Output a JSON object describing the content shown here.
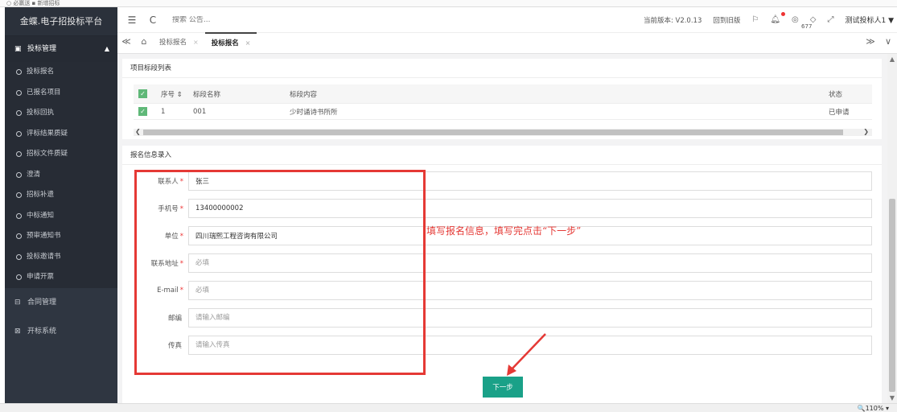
{
  "browser_strip": "○ 必赢送 ▪ 新增招标",
  "sidebar": {
    "brand": "金蝶.电子招投标平台",
    "group": {
      "icon": "▣",
      "label": "投标管理",
      "caret": "▲"
    },
    "items": [
      {
        "label": "投标报名"
      },
      {
        "label": "已报名项目"
      },
      {
        "label": "投标回执"
      },
      {
        "label": "评标结果质疑"
      },
      {
        "label": "招标文件质疑"
      },
      {
        "label": "澄清"
      },
      {
        "label": "招标补遗"
      },
      {
        "label": "中标通知"
      },
      {
        "label": "预审通知书"
      },
      {
        "label": "投标邀请书"
      },
      {
        "label": "申请开票"
      }
    ],
    "groups_collapsed": [
      {
        "icon": "⊟",
        "label": "合同管理"
      },
      {
        "icon": "⊠",
        "label": "开标系统"
      }
    ]
  },
  "header": {
    "menu_icon": "☰",
    "refresh_icon": "C",
    "search_placeholder": "搜索 公告...",
    "version": "当前版本: V2.0.13",
    "old_version_link": "回到旧版",
    "bell_count": "677",
    "user": "测试投标人1 ▼"
  },
  "tabs": {
    "back": "≪",
    "home": "⌂",
    "items": [
      {
        "label": "投标报名",
        "close": "×"
      },
      {
        "label": "投标报名",
        "close": "×"
      }
    ],
    "forward": "≫",
    "more": "∨"
  },
  "section_list": {
    "title": "项目标段列表",
    "columns": {
      "no": "序号 ⇕",
      "name": "标段名称",
      "content": "标段内容",
      "status": "状态"
    },
    "rows": [
      {
        "no": "1",
        "name": "001",
        "content": "少时诵诗书所所",
        "status": "已申请"
      }
    ]
  },
  "form": {
    "title": "报名信息录入",
    "fields": [
      {
        "label": "联系人",
        "required": "*",
        "value": "张三",
        "placeholder": ""
      },
      {
        "label": "手机号",
        "required": "*",
        "value": "13400000002",
        "placeholder": ""
      },
      {
        "label": "单位",
        "required": "*",
        "value": "四川瑞熙工程咨询有限公司",
        "placeholder": ""
      },
      {
        "label": "联系地址",
        "required": "*",
        "value": "",
        "placeholder": "必填"
      },
      {
        "label": "E-mail",
        "required": "*",
        "value": "",
        "placeholder": "必填"
      },
      {
        "label": "邮编",
        "required": "",
        "value": "",
        "placeholder": "请输入邮编"
      },
      {
        "label": "传真",
        "required": "",
        "value": "",
        "placeholder": "请输入传真"
      }
    ],
    "next_button": "下一步"
  },
  "annotation": {
    "text": "填写报名信息，填写完点击“下一步”",
    "color": "#e53935"
  },
  "status": {
    "zoom": "🔍110% ▾"
  }
}
